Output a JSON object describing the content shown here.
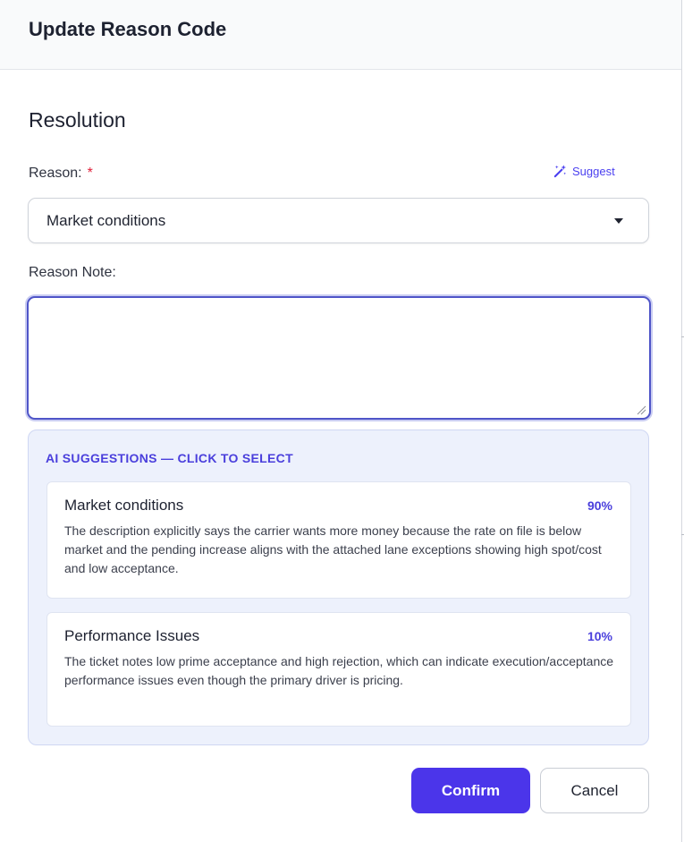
{
  "modal": {
    "title": "Update Reason Code",
    "section_title": "Resolution"
  },
  "reason": {
    "label": "Reason:",
    "required_mark": "*",
    "suggest_label": "Suggest",
    "selected_value": "Market conditions"
  },
  "reason_note": {
    "label": "Reason Note:",
    "value": ""
  },
  "ai_suggestions": {
    "heading": "AI SUGGESTIONS — CLICK TO SELECT",
    "items": [
      {
        "title": "Market conditions",
        "confidence": "90%",
        "description": "The description explicitly says the carrier wants more money because the rate on file is below market and the pending increase aligns with the attached lane exceptions showing high spot/cost and low acceptance."
      },
      {
        "title": "Performance Issues",
        "confidence": "10%",
        "description": "The ticket notes low prime acceptance and high rejection, which can indicate execution/acceptance performance issues even though the primary driver is pricing."
      }
    ]
  },
  "actions": {
    "confirm_label": "Confirm",
    "cancel_label": "Cancel"
  },
  "colors": {
    "accent": "#4b35ea",
    "accent_text": "#4a3fdc",
    "required": "#e0203a",
    "panel_bg": "#edf1fc"
  },
  "icons": {
    "suggest": "magic-wand-icon",
    "select_caret": "caret-down-icon",
    "textarea_resize": "resize-grip-icon"
  }
}
